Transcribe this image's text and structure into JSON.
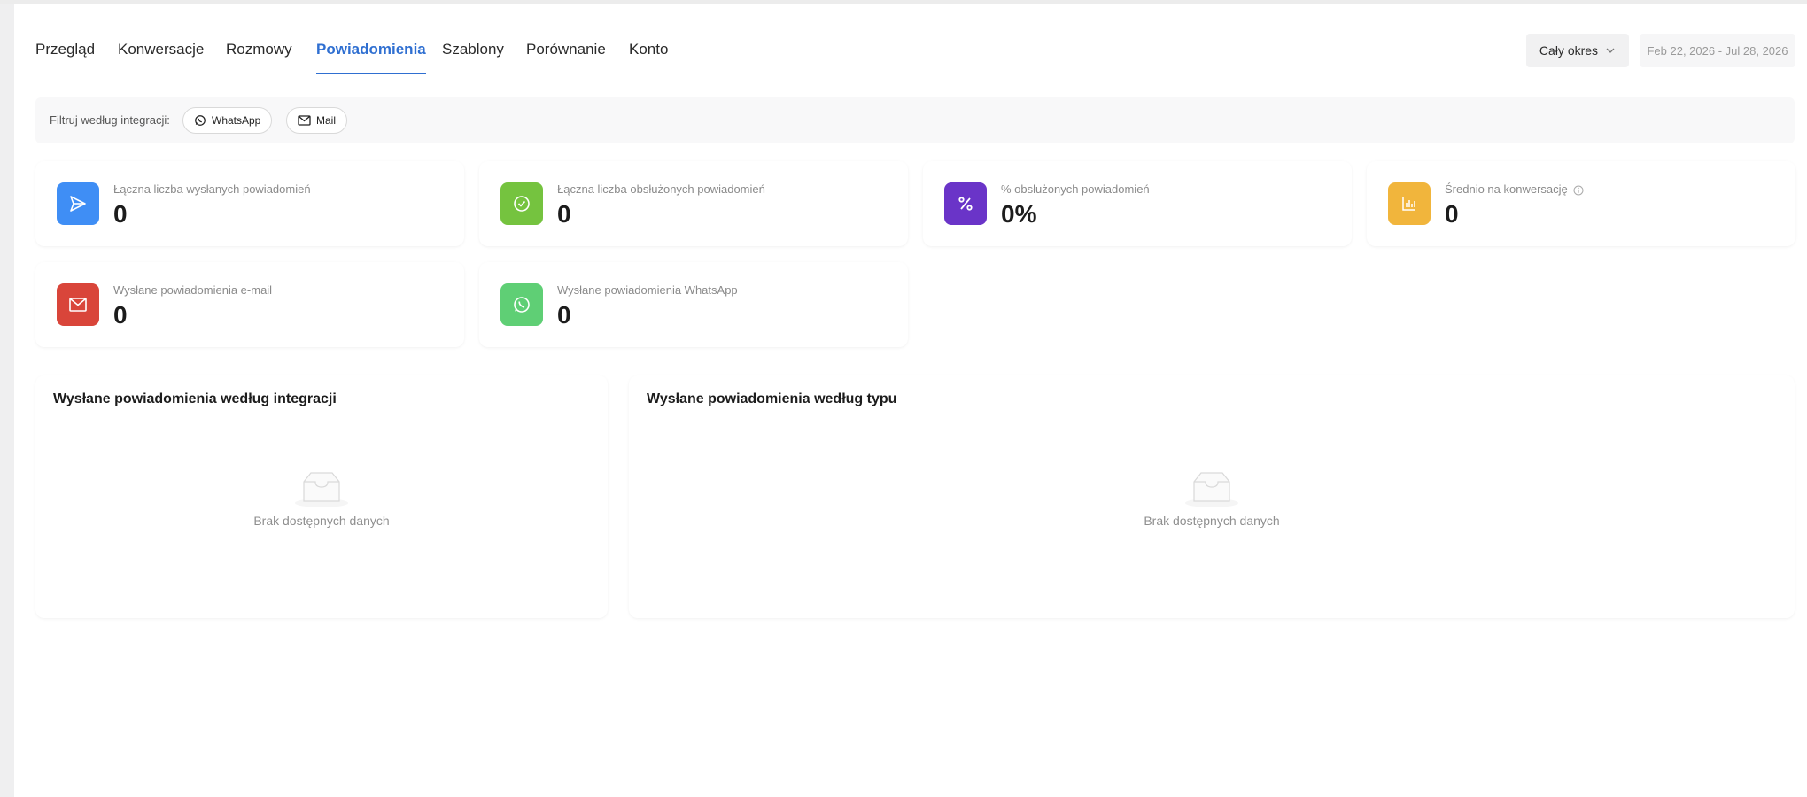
{
  "tabs": [
    {
      "label": "Przegląd",
      "active": false
    },
    {
      "label": "Konwersacje",
      "active": false
    },
    {
      "label": "Rozmowy",
      "active": false
    },
    {
      "label": "Powiadomienia",
      "active": true
    },
    {
      "label": "Szablony",
      "active": false
    },
    {
      "label": "Porównanie",
      "active": false
    },
    {
      "label": "Konto",
      "active": false
    }
  ],
  "header": {
    "period_label": "Cały okres",
    "date_range": "Feb 22, 2026 - Jul 28, 2026"
  },
  "filter": {
    "label": "Filtruj według integracji:",
    "chips": [
      {
        "label": "WhatsApp",
        "icon": "whatsapp-icon"
      },
      {
        "label": "Mail",
        "icon": "mail-icon"
      }
    ]
  },
  "stats": [
    {
      "label": "Łączna liczba wysłanych powiadomień",
      "value": "0",
      "icon": "send-icon",
      "color": "#3f8ef5"
    },
    {
      "label": "Łączna liczba obsłużonych powiadomień",
      "value": "0",
      "icon": "check-circle-icon",
      "color": "#75c33f"
    },
    {
      "label": "% obsłużonych powiadomień",
      "value": "0%",
      "icon": "percent-icon",
      "color": "#6a34c8"
    },
    {
      "label": "Średnio na konwersację",
      "value": "0",
      "icon": "bar-chart-icon",
      "color": "#f1b53c"
    },
    {
      "label": "Wysłane powiadomienia e-mail",
      "value": "0",
      "icon": "mail-icon",
      "color": "#d9453a"
    },
    {
      "label": "Wysłane powiadomienia WhatsApp",
      "value": "0",
      "icon": "whatsapp-icon",
      "color": "#5fcf75"
    }
  ],
  "panels": [
    {
      "title": "Wysłane powiadomienia według integracji",
      "empty_text": "Brak dostępnych danych"
    },
    {
      "title": "Wysłane powiadomienia według typu",
      "empty_text": "Brak dostępnych danych"
    }
  ]
}
